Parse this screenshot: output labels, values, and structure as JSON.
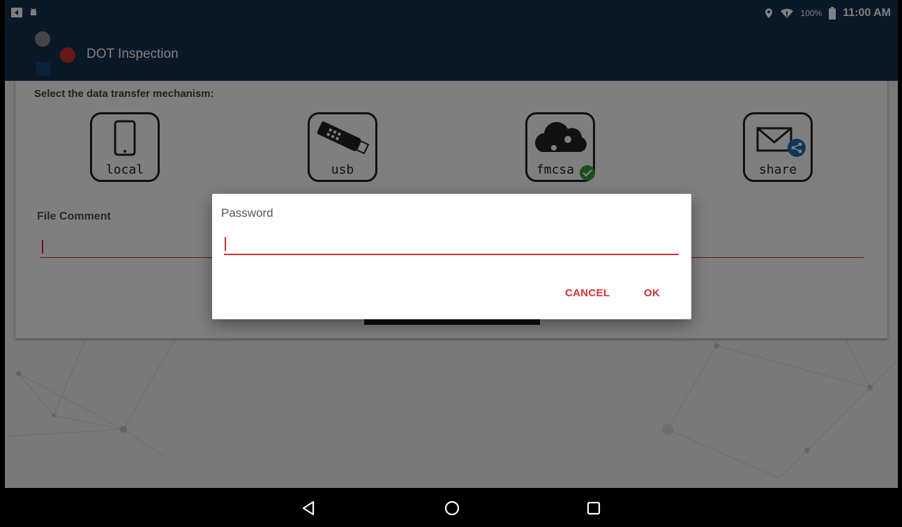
{
  "status_bar": {
    "battery_percent": "100%",
    "time": "11:00 AM",
    "icons": [
      "notification-icon",
      "android-icon",
      "location-icon",
      "wifi-icon",
      "battery-icon"
    ]
  },
  "app_bar": {
    "title": "DOT Inspection",
    "logo_colors": [
      "#8a8a8a",
      "#d32f2f",
      "#1d6fb5"
    ]
  },
  "transfer": {
    "prompt": "Select the data transfer mechanism:",
    "options": [
      {
        "label": "local",
        "icon": "phone-icon"
      },
      {
        "label": "usb",
        "icon": "usb-drive-icon"
      },
      {
        "label": "fmcsa",
        "icon": "cloud-icon",
        "selected": true
      },
      {
        "label": "share",
        "icon": "mail-share-icon"
      }
    ]
  },
  "file_comment": {
    "label": "File Comment",
    "value": ""
  },
  "dialog": {
    "title": "Password",
    "value": "",
    "cancel_label": "CANCEL",
    "ok_label": "OK"
  },
  "nav": {
    "buttons": [
      "back-icon",
      "home-icon",
      "recents-icon"
    ]
  },
  "colors": {
    "primary": "#15324f",
    "accent": "#d32f2f",
    "check": "#2e9e3a",
    "share_badge": "#1d6fb5"
  }
}
